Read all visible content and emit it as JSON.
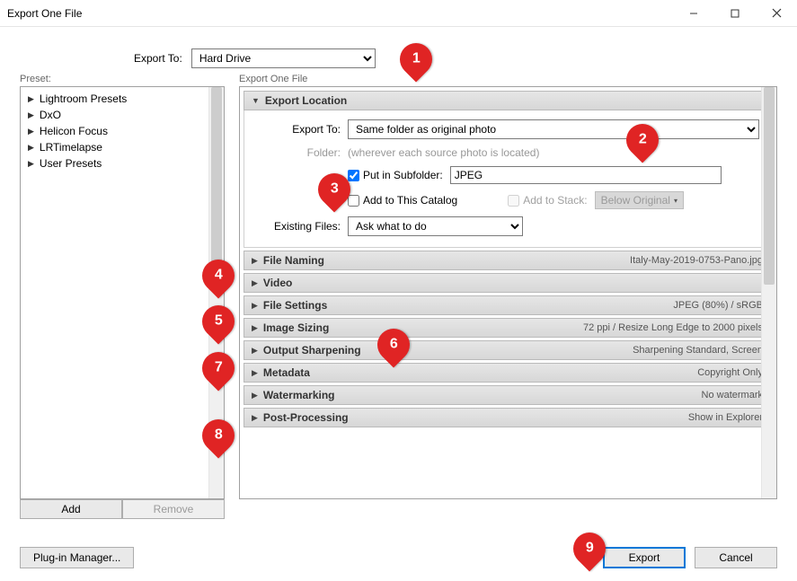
{
  "window": {
    "title": "Export One File"
  },
  "export_to": {
    "label": "Export To:",
    "value": "Hard Drive"
  },
  "preset": {
    "label": "Preset:",
    "items": [
      "Lightroom Presets",
      "DxO",
      "Helicon Focus",
      "LRTimelapse",
      "User Presets"
    ],
    "add_label": "Add",
    "remove_label": "Remove"
  },
  "right_panel_label": "Export One File",
  "export_location": {
    "title": "Export Location",
    "export_to_label": "Export To:",
    "export_to_value": "Same folder as original photo",
    "folder_label": "Folder:",
    "folder_hint": "(wherever each source photo is located)",
    "put_in_subfolder_label": "Put in Subfolder:",
    "put_in_subfolder_checked": true,
    "subfolder_value": "JPEG",
    "add_to_catalog_label": "Add to This Catalog",
    "add_to_stack_label": "Add to Stack:",
    "below_original_label": "Below Original",
    "existing_files_label": "Existing Files:",
    "existing_files_value": "Ask what to do"
  },
  "sections": {
    "file_naming": {
      "title": "File Naming",
      "summary": "Italy-May-2019-0753-Pano.jpg"
    },
    "video": {
      "title": "Video",
      "summary": ""
    },
    "file_settings": {
      "title": "File Settings",
      "summary": "JPEG (80%) / sRGB"
    },
    "image_sizing": {
      "title": "Image Sizing",
      "summary": "72 ppi / Resize Long Edge to 2000 pixels"
    },
    "output_sharpening": {
      "title": "Output Sharpening",
      "summary": "Sharpening Standard, Screen"
    },
    "metadata": {
      "title": "Metadata",
      "summary": "Copyright Only"
    },
    "watermarking": {
      "title": "Watermarking",
      "summary": "No watermark"
    },
    "post_processing": {
      "title": "Post-Processing",
      "summary": "Show in Explorer"
    }
  },
  "footer": {
    "plugin_manager_label": "Plug-in Manager...",
    "export_label": "Export",
    "cancel_label": "Cancel"
  },
  "callouts": [
    "1",
    "2",
    "3",
    "4",
    "5",
    "6",
    "7",
    "8",
    "9"
  ]
}
